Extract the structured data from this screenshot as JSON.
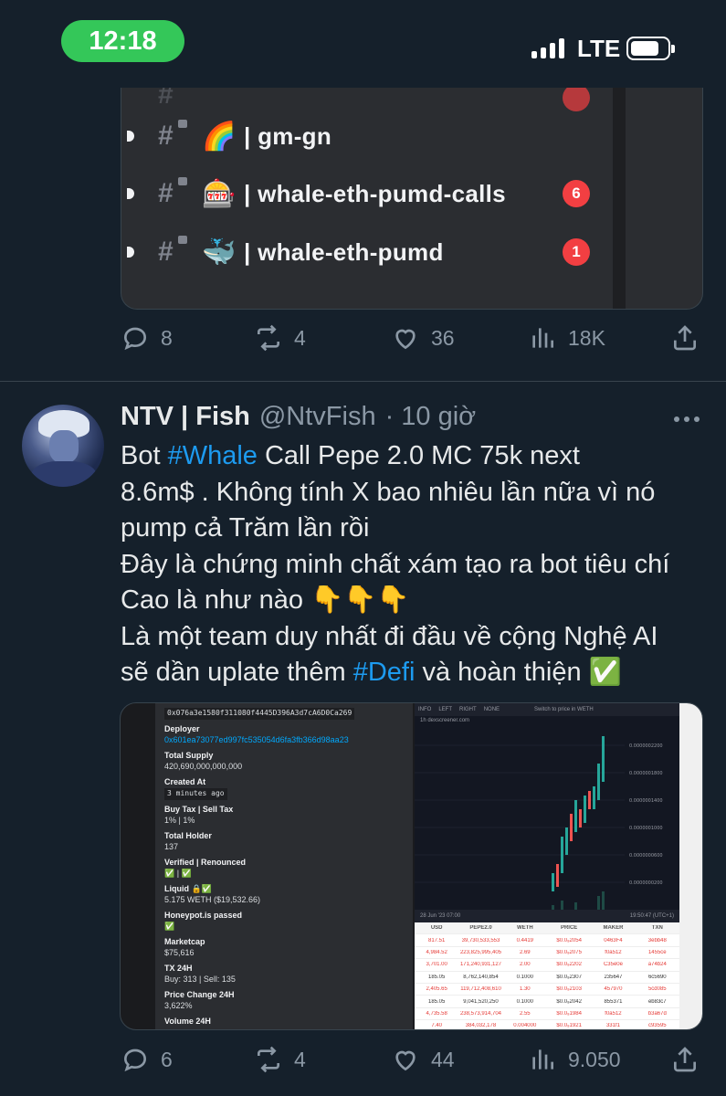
{
  "status_bar": {
    "time": "12:18",
    "network": "LTE"
  },
  "embed": {
    "channels": [
      {
        "emoji": "🌈",
        "name": "| gm-gn",
        "badge": ""
      },
      {
        "emoji": "🎰",
        "name": "| whale-eth-pumd-calls",
        "badge": "6"
      },
      {
        "emoji": "🐳",
        "name": "| whale-eth-pumd",
        "badge": "1"
      }
    ]
  },
  "tweet1_actions": {
    "replies": "8",
    "retweets": "4",
    "likes": "36",
    "views": "18K"
  },
  "tweet2": {
    "display_name": "NTV | Fish",
    "handle": "@NtvFish",
    "time": "· 10 giờ",
    "text": {
      "l1a": "Bot ",
      "tag1": "#Whale",
      "l1b": " Call Pepe 2.0 MC 75k next",
      "l2": "8.6m$ . Không tính X bao nhiêu lần nữa vì nó",
      "l3": "pump cả Trăm lần rồi",
      "l4": "Đây là chứng minh chất xám tạo ra bot tiêu chí",
      "l5": "Cao là như nào 👇👇👇",
      "l6": "Là một team duy nhất đi đầu về cộng Nghệ AI",
      "l7a": "sẽ dần uplate thêm ",
      "tag2": "#Defi",
      "l7b": " và hoàn thiện ✅"
    },
    "bot_info": {
      "pair": "0x076a3e1580f311080f4445D396A3d7cA6D0Ca269",
      "deployer_label": "Deployer",
      "deployer": "0x601ea73077ed997fc535054d6fa3fb366d98aa23",
      "supply_label": "Total Supply",
      "supply": "420,690,000,000,000",
      "created_label": "Created At",
      "created": "3 minutes ago",
      "tax_label": "Buy Tax | Sell Tax",
      "tax": "1% | 1%",
      "holder_label": "Total Holder",
      "holder": "137",
      "verified_label": "Verified | Renounced",
      "verified": "✅ | ✅",
      "liquid_label": "Liquid 🔒✅",
      "liquid": "5.175 WETH ($19,532.66)",
      "honeypot_label": "Honeypot.is passed",
      "honeypot": "✅",
      "mcap_label": "Marketcap",
      "mcap": "$75,616",
      "tx_label": "TX 24H",
      "tx": "Buy: 313 | Sell: 135",
      "pc_label": "Price Change 24H",
      "pc": "3,622%",
      "vol_label": "Volume 24H"
    },
    "dex": {
      "toolbar": [
        "INFO",
        "LEFT",
        "RIGHT",
        "NONE",
        "Switch to price in WETH"
      ],
      "source": "1h  dexscreener.com",
      "timebar_left": "28 Jun '23  07:00",
      "timebar_right": "19:50:47 (UTC+1)",
      "table_headers": [
        "USD",
        "PEPE2.0",
        "WETH",
        "PRICE",
        "MAKER",
        "TXN"
      ],
      "rows": [
        [
          "817.51",
          "39,730,533,553",
          "0.4419",
          "$0.0₈2054",
          "0463F4",
          "3ebb48"
        ],
        [
          "4,984.52",
          "223,825,995,405",
          "2.69",
          "$0.0₈2075",
          "f0a512",
          "1455ce"
        ],
        [
          "3,701.00",
          "171,240,931,127",
          "2.00",
          "$0.0₈2202",
          "C35e0e",
          "a74b24"
        ],
        [
          "185.05",
          "8,762,140,854",
          "0.1000",
          "$0.0₈2307",
          "235647",
          "6c5690"
        ],
        [
          "2,405.65",
          "119,712,408,610",
          "1.30",
          "$0.0₈2103",
          "457970",
          "5cd085"
        ],
        [
          "185.05",
          "9,041,520,250",
          "0.1000",
          "$0.0₈2042",
          "855371",
          "eb83c7"
        ],
        [
          "4,735.58",
          "238,573,914,704",
          "2.55",
          "$0.0₈1984",
          "f0a512",
          "b3a67d"
        ],
        [
          "7.40",
          "384,032,178",
          "0.004000",
          "$0.0₈1921",
          "331f1",
          "c93595"
        ]
      ]
    }
  },
  "tweet2_actions": {
    "replies": "6",
    "retweets": "4",
    "likes": "44",
    "views": "9.050"
  },
  "colors": {
    "background": "#15202b",
    "accent": "#1d9bf0",
    "status_green": "#34c759",
    "badge_red": "#f23f42"
  }
}
